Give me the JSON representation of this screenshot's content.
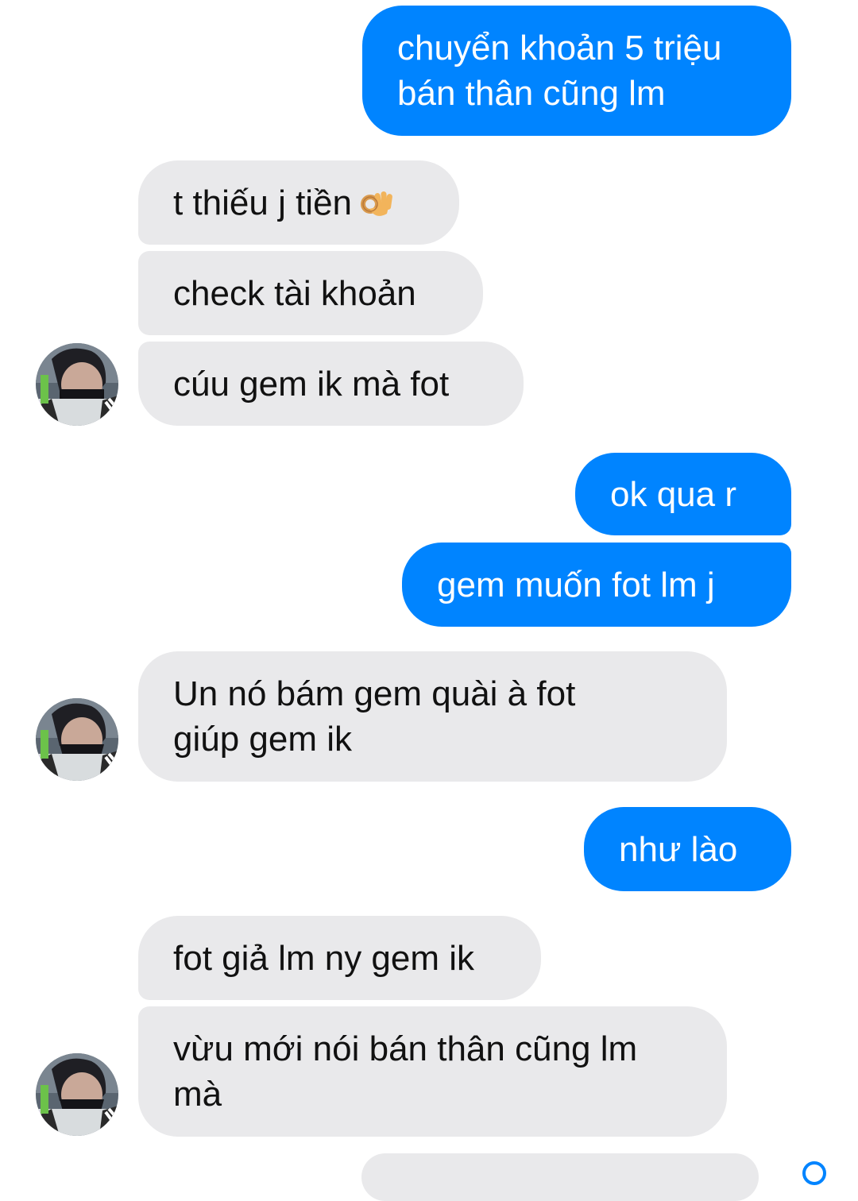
{
  "messages": [
    {
      "id": "m1",
      "side": "sent",
      "text": "chuyển khoản 5 triệu\nbán thân cũng lm"
    },
    {
      "id": "m2",
      "side": "received",
      "text": "t thiếu j tiền",
      "emoji": "ok-hand-emoji"
    },
    {
      "id": "m3",
      "side": "received",
      "text": "check tài khoản"
    },
    {
      "id": "m4",
      "side": "received",
      "text": "cúu gem ik mà fot"
    },
    {
      "id": "m5",
      "side": "sent",
      "text": "ok qua r"
    },
    {
      "id": "m6",
      "side": "sent",
      "text": "gem muốn fot lm j"
    },
    {
      "id": "m7",
      "side": "received",
      "text": "Un nó bám gem quài à fot\ngiúp gem ik"
    },
    {
      "id": "m8",
      "side": "sent",
      "text": "như lào"
    },
    {
      "id": "m9",
      "side": "received",
      "text": "fot giả lm ny gem ik"
    },
    {
      "id": "m10",
      "side": "received",
      "text": "vừu mới nói bán thân cũng lm\nmà"
    }
  ],
  "colors": {
    "sent_bubble": "#0084ff",
    "received_bubble": "#e9e9eb",
    "background": "#ffffff"
  },
  "icons": {
    "avatar": "contact-avatar",
    "emoji": "ok-hand-emoji"
  }
}
